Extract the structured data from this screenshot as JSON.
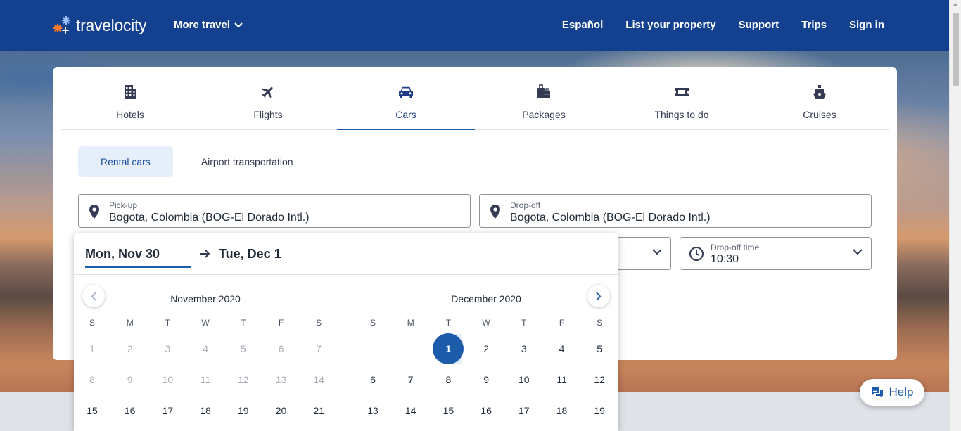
{
  "header": {
    "logo_text": "travelocity",
    "more_travel": "More travel",
    "nav": [
      "Español",
      "List your property",
      "Support",
      "Trips",
      "Sign in"
    ]
  },
  "tabs": [
    {
      "label": "Hotels",
      "icon": "building-icon"
    },
    {
      "label": "Flights",
      "icon": "plane-icon"
    },
    {
      "label": "Cars",
      "icon": "car-icon",
      "active": true
    },
    {
      "label": "Packages",
      "icon": "luggage-icon"
    },
    {
      "label": "Things to do",
      "icon": "ticket-icon"
    },
    {
      "label": "Cruises",
      "icon": "ship-icon"
    }
  ],
  "subtabs": [
    "Rental cars",
    "Airport transportation"
  ],
  "pickup": {
    "label": "Pick-up",
    "value": "Bogota, Colombia (BOG-El Dorado Intl.)"
  },
  "dropoff": {
    "label": "Drop-off",
    "value": "Bogota, Colombia (BOG-El Dorado Intl.)"
  },
  "dropoff_time": {
    "label": "Drop-off time",
    "value": "10:30"
  },
  "datepicker": {
    "start": "Mon, Nov 30",
    "end": "Tue, Dec 1",
    "weekdays": [
      "S",
      "M",
      "T",
      "W",
      "T",
      "F",
      "S"
    ],
    "months": [
      {
        "title": "November 2020",
        "leading_blanks": 0,
        "rows": [
          [
            "1",
            "2",
            "3",
            "4",
            "5",
            "6",
            "7"
          ],
          [
            "8",
            "9",
            "10",
            "11",
            "12",
            "13",
            "14"
          ],
          [
            "15",
            "16",
            "17",
            "18",
            "19",
            "20",
            "21"
          ]
        ],
        "disabled_through": 15
      },
      {
        "title": "December 2020",
        "leading_blanks": 2,
        "rows": [
          [
            "",
            "",
            "1",
            "2",
            "3",
            "4",
            "5"
          ],
          [
            "6",
            "7",
            "8",
            "9",
            "10",
            "11",
            "12"
          ],
          [
            "13",
            "14",
            "15",
            "16",
            "17",
            "18",
            "19"
          ]
        ],
        "selected": "1"
      }
    ]
  },
  "help_label": "Help",
  "colors": {
    "brand": "#13418f",
    "accent": "#1d5bab"
  }
}
